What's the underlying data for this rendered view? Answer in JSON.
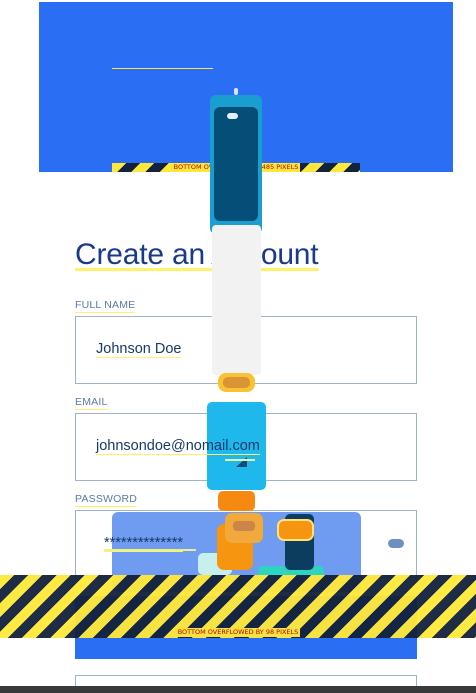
{
  "form": {
    "title": "Create an Account",
    "fields": [
      {
        "label": "FULL NAME",
        "value": "Johnson Doe"
      },
      {
        "label": "EMAIL",
        "value": "johnsondoe@nomail.com"
      },
      {
        "label": "PASSWORD",
        "value": "**************"
      }
    ]
  },
  "debug": {
    "overflow_top": "BOTTOM OVERFLOWED BY 485 PIXELS",
    "overflow_bottom": "BOTTOM OVERFLOWED BY 98 PIXELS"
  },
  "colors": {
    "primary": "#2a6ff3",
    "title": "#193a8a",
    "overflow_stripe_yellow": "#ffe83b",
    "overflow_stripe_dark": "#14233d",
    "overflow_text": "#c40000"
  },
  "icons": [
    "phone-illustration",
    "password-visibility-toggle-icon"
  ]
}
